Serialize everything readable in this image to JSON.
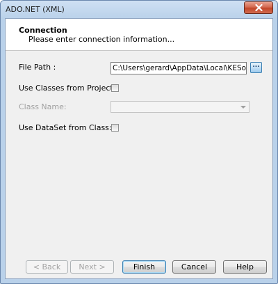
{
  "window": {
    "title": "ADO.NET (XML)"
  },
  "header": {
    "title": "Connection",
    "subtitle": "Please enter connection information..."
  },
  "form": {
    "file_path_label": "File Path :",
    "file_path_value": "C:\\Users\\gerard\\AppData\\Local\\KESoftware\\F",
    "browse_label": "...",
    "use_classes_label": "Use Classes from Project:",
    "use_classes_checked": false,
    "class_name_label": "Class Name:",
    "class_name_value": "",
    "use_dataset_label": "Use DataSet from Class:",
    "use_dataset_checked": false
  },
  "buttons": {
    "back": "< Back",
    "next": "Next >",
    "finish": "Finish",
    "cancel": "Cancel",
    "help": "Help"
  },
  "icons": {
    "close": "close-icon",
    "dropdown": "chevron-down-icon"
  },
  "colors": {
    "title_bar": "#b9d1ea",
    "close_button": "#c24629",
    "dialog_bg": "#f0f0f0",
    "disabled_text": "#a0a0a0"
  }
}
